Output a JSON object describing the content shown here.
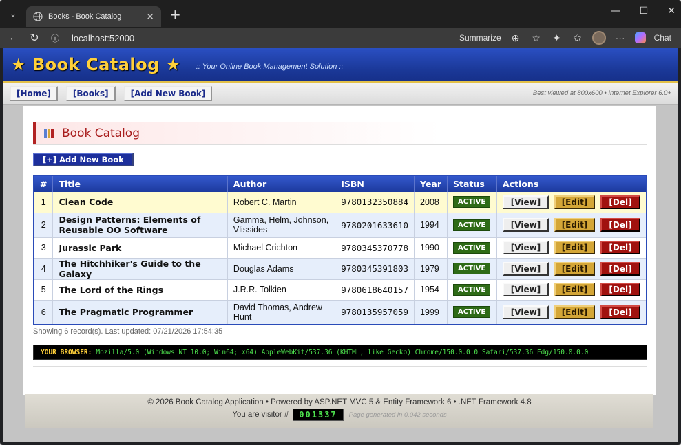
{
  "browser": {
    "tab_title": "Books - Book Catalog",
    "url": "localhost:52000",
    "summarize_label": "Summarize",
    "chat_label": "Chat"
  },
  "site": {
    "logo": "★ Book Catalog ★",
    "tagline": ":: Your Online Book Management Solution ::",
    "nav": [
      {
        "label": "[Home]"
      },
      {
        "label": "[Books]"
      },
      {
        "label": "[Add New Book]"
      }
    ],
    "best_viewed": "Best viewed at 800x600 • Internet Explorer 6.0+"
  },
  "page": {
    "heading": "Book Catalog",
    "add_button": "[+] Add New Book",
    "columns": [
      "#",
      "Title",
      "Author",
      "ISBN",
      "Year",
      "Status",
      "Actions"
    ],
    "rows": [
      {
        "num": "1",
        "title": "Clean Code",
        "author": "Robert C. Martin",
        "isbn": "9780132350884",
        "year": "2008",
        "status": "ACTIVE"
      },
      {
        "num": "2",
        "title": "Design Patterns: Elements of Reusable OO Software",
        "author": "Gamma, Helm, Johnson, Vlissides",
        "isbn": "9780201633610",
        "year": "1994",
        "status": "ACTIVE"
      },
      {
        "num": "3",
        "title": "Jurassic Park",
        "author": "Michael Crichton",
        "isbn": "9780345370778",
        "year": "1990",
        "status": "ACTIVE"
      },
      {
        "num": "4",
        "title": "The Hitchhiker's Guide to the Galaxy",
        "author": "Douglas Adams",
        "isbn": "9780345391803",
        "year": "1979",
        "status": "ACTIVE"
      },
      {
        "num": "5",
        "title": "The Lord of the Rings",
        "author": "J.R.R. Tolkien",
        "isbn": "9780618640157",
        "year": "1954",
        "status": "ACTIVE"
      },
      {
        "num": "6",
        "title": "The Pragmatic Programmer",
        "author": "David Thomas, Andrew Hunt",
        "isbn": "9780135957059",
        "year": "1999",
        "status": "ACTIVE"
      }
    ],
    "action_labels": {
      "view": "[View]",
      "edit": "[Edit]",
      "del": "[Del]"
    },
    "records_text": "Showing 6 record(s). Last updated: 07/21/2026 17:54:35",
    "ua_label": "YOUR BROWSER:",
    "ua_value": "Mozilla/5.0 (Windows NT 10.0; Win64; x64) AppleWebKit/537.36 (KHTML, like Gecko) Chrome/150.0.0.0 Safari/537.36 Edg/150.0.0.0"
  },
  "footer": {
    "copyright": "© 2026 Book Catalog Application • Powered by ASP.NET MVC 5 & Entity Framework 6 • .NET Framework 4.8",
    "visitor_label": "You are visitor #",
    "visitor_count": "001337",
    "generated": "Page generated in 0.042 seconds"
  },
  "colors": {
    "banner": "#1a3796",
    "logo": "#ffd03a",
    "status_active": "#2e6b16",
    "edit": "#d4a637",
    "delete": "#a1120f"
  }
}
